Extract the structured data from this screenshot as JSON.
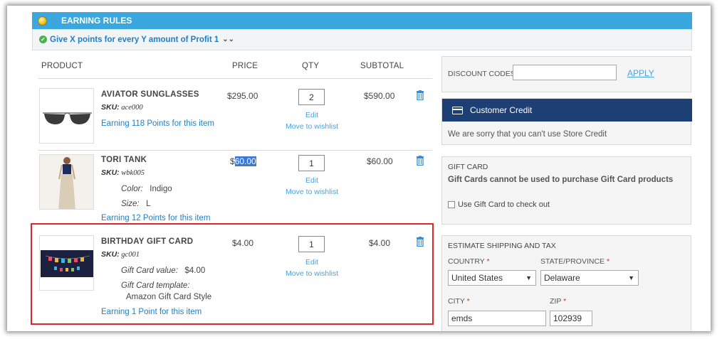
{
  "earning_rules": {
    "title": "EARNING RULES",
    "rule_text": "Give X points for every Y amount of Profit 1"
  },
  "cart": {
    "headers": {
      "product": "PRODUCT",
      "price": "PRICE",
      "qty": "QTY",
      "subtotal": "SUBTOTAL"
    },
    "edit_label": "Edit",
    "wishlist_label": "Move to wishlist",
    "items": [
      {
        "name": "AVIATOR SUNGLASSES",
        "sku_label": "SKU:",
        "sku": "ace000",
        "price": "$295.00",
        "qty": "2",
        "subtotal": "$590.00",
        "earning": "Earning 118 Points for this item"
      },
      {
        "name": "TORI TANK",
        "sku_label": "SKU:",
        "sku": "wbk005",
        "price_prefix": "$",
        "price_selected": "60.00",
        "qty": "1",
        "subtotal": "$60.00",
        "options": [
          {
            "label": "Color:",
            "value": "Indigo"
          },
          {
            "label": "Size:",
            "value": "L"
          }
        ],
        "earning": "Earning 12 Points for this item"
      },
      {
        "name": "BIRTHDAY GIFT CARD",
        "sku_label": "SKU:",
        "sku": "gc001",
        "price": "$4.00",
        "qty": "1",
        "subtotal": "$4.00",
        "options": [
          {
            "label": "Gift Card value:",
            "value": "$4.00"
          },
          {
            "label": "Gift Card template:",
            "value": "Amazon Gift Card Style"
          }
        ],
        "earning": "Earning 1 Point for this item"
      }
    ]
  },
  "discount": {
    "label": "DISCOUNT CODES",
    "value": "",
    "apply_label": "APPLY"
  },
  "customer_credit": {
    "title": "Customer Credit",
    "message": "We are sorry that you can't use Store Credit"
  },
  "gift_card": {
    "title": "GIFT CARD",
    "message": "Gift Cards cannot be used to purchase Gift Card products",
    "checkbox_label": "Use Gift Card to check out"
  },
  "shipping": {
    "title": "ESTIMATE SHIPPING AND TAX",
    "country_label": "COUNTRY",
    "country_value": "United States",
    "state_label": "STATE/PROVINCE",
    "state_value": "Delaware",
    "city_label": "CITY",
    "city_value": "emds",
    "zip_label": "ZIP",
    "zip_value": "102939",
    "required_mark": "*"
  },
  "colors": {
    "accent_blue": "#3aa7de",
    "link_blue": "#1f7fc6",
    "credit_header": "#1d3f73",
    "highlight_red": "#e0242b"
  }
}
